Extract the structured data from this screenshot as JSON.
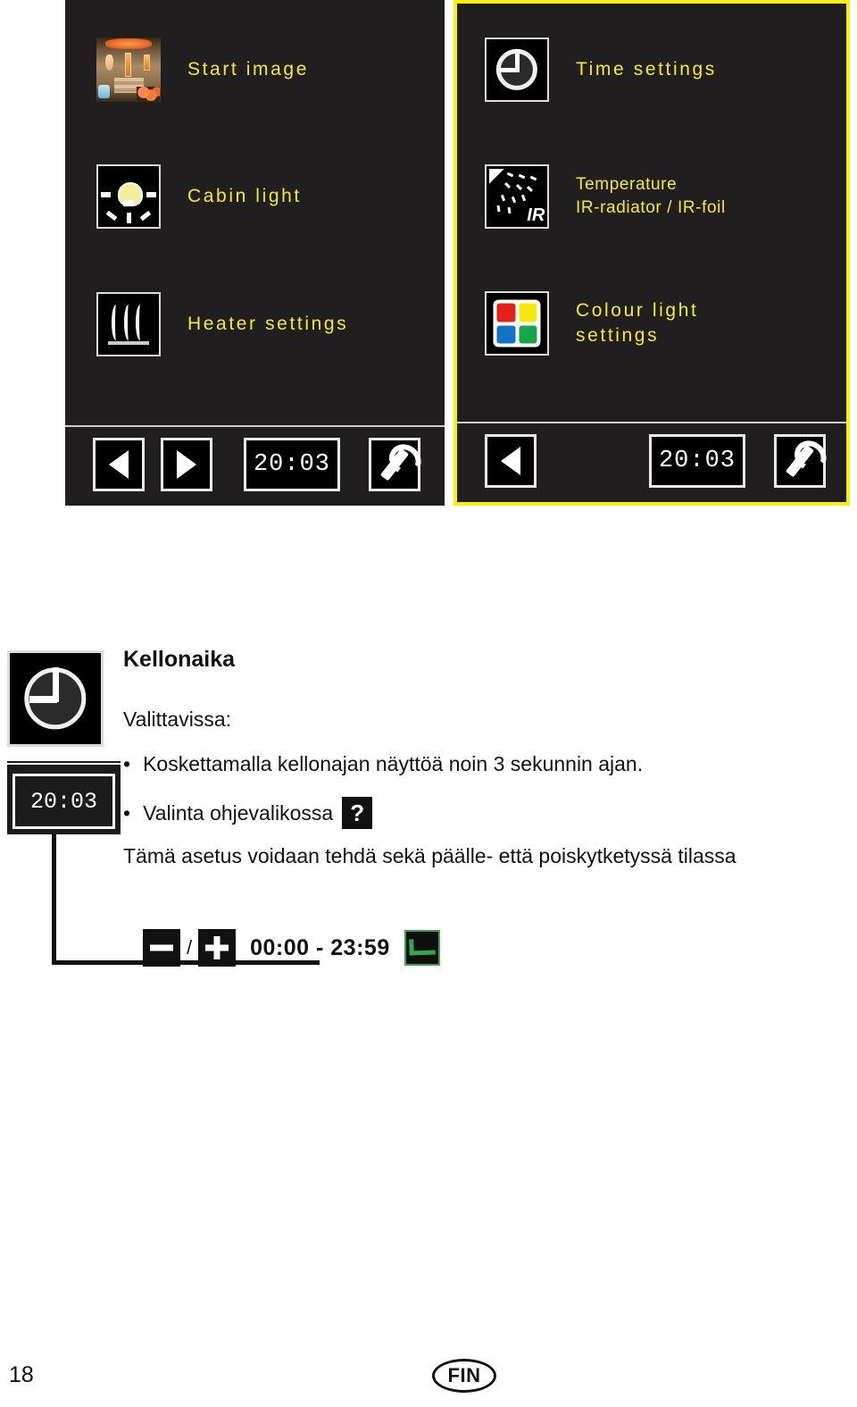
{
  "panels": {
    "left": {
      "name": "main-menu-page-1",
      "items": [
        {
          "icon": "sauna-cabin-photo-icon",
          "label": "Start image"
        },
        {
          "icon": "light-bulb-icon",
          "label": "Cabin light"
        },
        {
          "icon": "heater-waves-icon",
          "label": "Heater settings"
        }
      ],
      "bar": {
        "prev_label": "◀",
        "next_label": "▶",
        "time": "20:03",
        "wrench_label": "settings"
      }
    },
    "right": {
      "name": "main-menu-page-2",
      "highlight_color": "#f7f010",
      "items": [
        {
          "icon": "clock-icon",
          "label": "Time settings"
        },
        {
          "icon": "ir-radiator-icon",
          "label": "Temperature\nIR-radiator / IR-foil"
        },
        {
          "icon": "colour-grid-icon",
          "label": "Colour light\nsettings"
        }
      ],
      "bar": {
        "prev_label": "◀",
        "time": "20:03",
        "wrench_label": "settings"
      }
    }
  },
  "description": {
    "icon": "clock-icon",
    "display_time": "20:03",
    "title": "Kellonaika",
    "subtitle": "Valittavissa:",
    "bullets": [
      "Koskettamalla kellonajan näyttöä noin 3 sekunnin ajan.",
      "Valinta ohjevalikossa"
    ],
    "question_mark": "?",
    "paragraph": "Tämä asetus voidaan tehdä sekä päälle- että poiskytketyssä tilassa",
    "range": {
      "minus_label": "−",
      "plus_label": "+",
      "separator": "/",
      "value": "00:00 - 23:59",
      "confirm": "✓",
      "confirm_color": "#2fa84f"
    }
  },
  "footer": {
    "page_number": "18",
    "language_badge": "FIN"
  },
  "colour_icon_swatches": [
    "#e32119",
    "#f7e711",
    "#1374c4",
    "#17a74a"
  ]
}
